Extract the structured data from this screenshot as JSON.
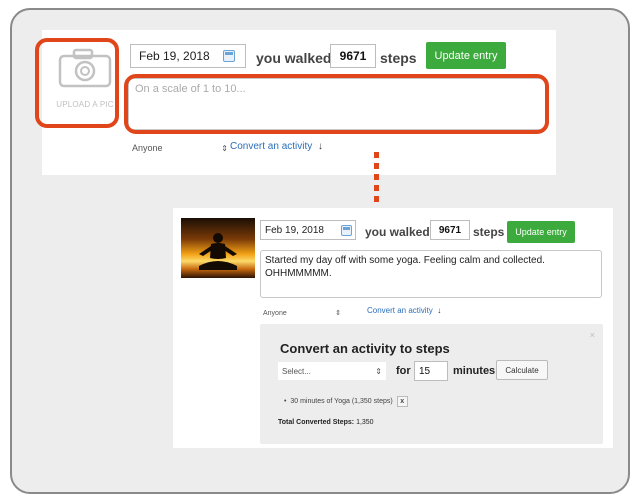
{
  "top": {
    "upload_label": "UPLOAD A PIC",
    "date": "Feb 19, 2018",
    "walked_label": "you walked",
    "steps_value": "9671",
    "steps_label": "steps",
    "update_button": "Update entry",
    "textarea_placeholder": "On a scale of 1 to 10...",
    "privacy_select": "Anyone",
    "convert_link": "Convert an activity"
  },
  "bottom": {
    "date": "Feb 19, 2018",
    "walked_label": "you walked",
    "steps_value": "9671",
    "steps_label": "steps",
    "update_button": "Update entry",
    "entry_text": "Started my day off with some yoga. Feeling calm and collected. OHHMMMMM.",
    "privacy_select": "Anyone",
    "convert_link": "Convert an activity",
    "convert_panel": {
      "title": "Convert an activity to steps",
      "activity_select": "Select...",
      "for_label": "for",
      "minutes_value": "15",
      "minutes_label": "minutes",
      "calculate_button": "Calculate",
      "converted_item": "30 minutes of Yoga (1,350 steps)",
      "remove_label": "x",
      "total_label": "Total Converted Steps:",
      "total_value": "1,350"
    }
  },
  "colors": {
    "highlight": "#e0461a",
    "green_button": "#3caa3c",
    "link": "#2a6ebb"
  }
}
